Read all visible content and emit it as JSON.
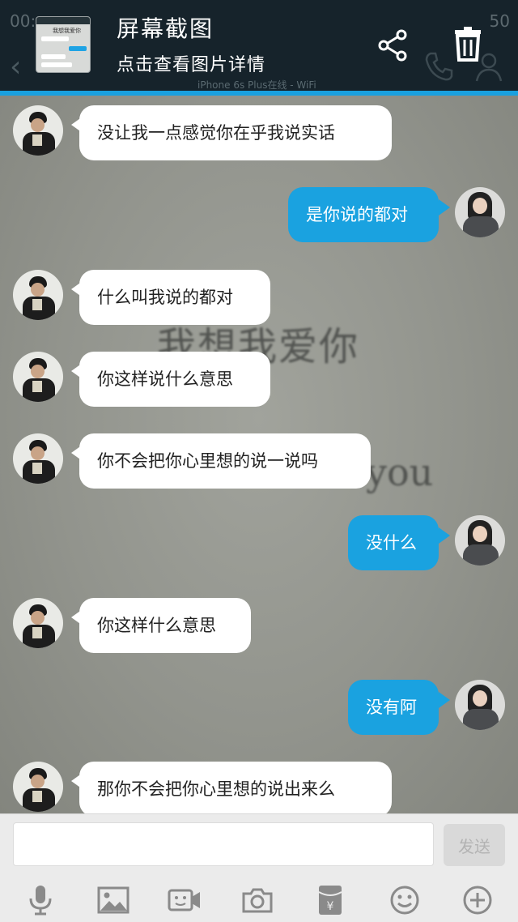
{
  "status_bar": {
    "time_partial": "00:",
    "battery": "50"
  },
  "header": {
    "title": "屏幕截图",
    "subtitle": "点击查看图片详情",
    "watermark": "iPhone 6s Plus在线 - WiFi",
    "thumb_text": "我想我爱你"
  },
  "background_image_text": {
    "cn": "我想我爱你",
    "en": "you"
  },
  "messages": [
    {
      "side": "in",
      "text": "没让我一点感觉你在乎我说实话"
    },
    {
      "side": "out",
      "text": "是你说的都对"
    },
    {
      "side": "in",
      "text": "什么叫我说的都对"
    },
    {
      "side": "in",
      "text": "你这样说什么意思"
    },
    {
      "side": "in",
      "text": "你不会把你心里想的说一说吗"
    },
    {
      "side": "out",
      "text": "没什么"
    },
    {
      "side": "in",
      "text": "你这样什么意思"
    },
    {
      "side": "out",
      "text": "没有阿"
    },
    {
      "side": "in",
      "text": "那你不会把你心里想的说出来么"
    }
  ],
  "input": {
    "value": "",
    "send_label": "发送"
  },
  "toolbar_icons": [
    "microphone-icon",
    "image-icon",
    "video-icon",
    "camera-icon",
    "red-packet-icon",
    "emoji-icon",
    "plus-icon"
  ],
  "colors": {
    "accent": "#1aa2e0",
    "header_bg": "#16232b",
    "incoming_bubble": "#ffffff"
  }
}
